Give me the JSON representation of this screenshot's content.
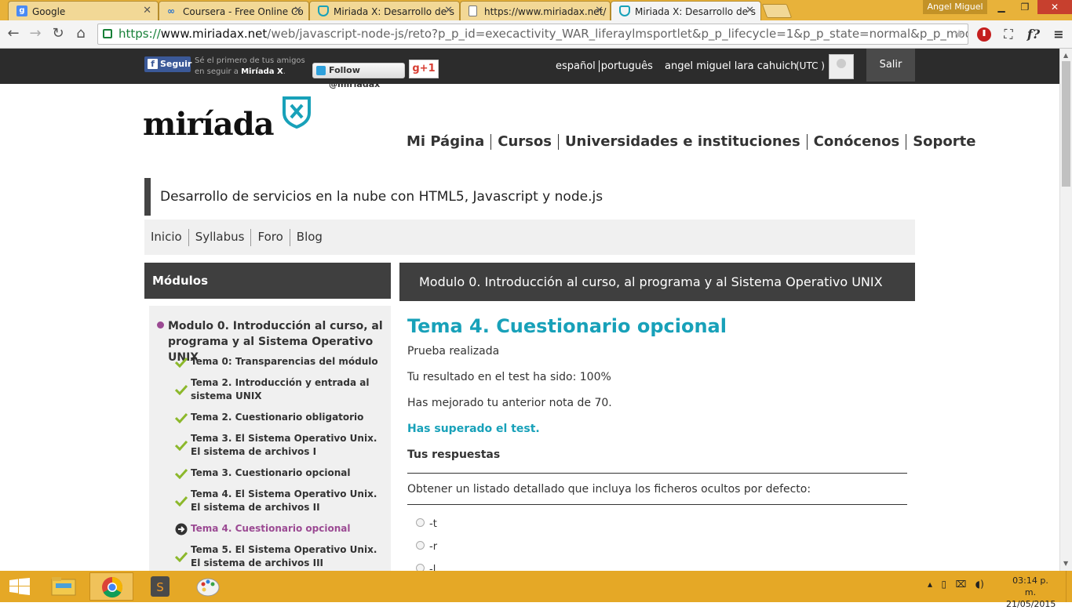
{
  "browser": {
    "tabs": [
      {
        "title": "Google",
        "icon": "google-icon",
        "active": false
      },
      {
        "title": "Coursera - Free Online Co",
        "icon": "coursera-icon",
        "active": false
      },
      {
        "title": "Miriada X: Desarrollo de s",
        "icon": "miriada-icon",
        "active": false
      },
      {
        "title": "https://www.miriadax.net/",
        "icon": "page-icon",
        "active": false
      },
      {
        "title": "Miriada X: Desarrollo de s",
        "icon": "miriada-icon",
        "active": true
      }
    ],
    "profile_name": "Angel Miguel",
    "url_scheme": "https://",
    "url_host": "www.miriadax.net",
    "url_rest": "/web/javascript-node-js/reto?p_p_id=execactivity_WAR_liferaylmsportlet&p_p_lifecycle=1&p_p_state=normal&p_p_mode=vie"
  },
  "topbar": {
    "fb_button": "Seguir",
    "fb_text_1": "Sé el primero de tus amigos en seguir a ",
    "fb_text_brand": "Miríada X",
    "fb_text_end": ".",
    "twitter_button": "Follow @miriadax",
    "gplus": "g+1",
    "lang_es": "español",
    "lang_pt": "português",
    "username": "angel miguel lara cahuich",
    "timezone": "(UTC )",
    "logout": "Salir"
  },
  "site": {
    "logo_text": "miríada",
    "menu": [
      "Mi Página",
      "Cursos",
      "Universidades e instituciones",
      "Conócenos",
      "Soporte"
    ],
    "course_title": "Desarrollo de servicios en la nube con HTML5, Javascript y node.js",
    "course_nav": [
      "Inicio",
      "Syllabus",
      "Foro",
      "Blog"
    ]
  },
  "sidebar": {
    "header": "Módulos",
    "module_title": "Modulo 0. Introducción al curso, al programa y al Sistema Operativo UNIX",
    "items": [
      {
        "label": "Tema 0: Transparencias del módulo",
        "status": "done"
      },
      {
        "label": "Tema 2. Introducción y entrada al sistema UNIX",
        "status": "done"
      },
      {
        "label": "Tema 2. Cuestionario obligatorio",
        "status": "done"
      },
      {
        "label": "Tema 3. El Sistema Operativo Unix. El sistema de archivos I",
        "status": "done"
      },
      {
        "label": "Tema 3. Cuestionario opcional",
        "status": "done"
      },
      {
        "label": "Tema 4. El Sistema Operativo Unix. El sistema de archivos II",
        "status": "done"
      },
      {
        "label": "Tema 4. Cuestionario opcional",
        "status": "current"
      },
      {
        "label": "Tema 5. El Sistema Operativo Unix. El sistema de archivos III",
        "status": "done"
      }
    ]
  },
  "content": {
    "header": "Modulo 0. Introducción al curso, al programa y al Sistema Operativo UNIX",
    "title": "Tema 4. Cuestionario opcional",
    "status": "Prueba realizada",
    "result": "Tu resultado en el test ha sido: 100%",
    "improved": "Has mejorado tu anterior nota de 70.",
    "passed": "Has superado el test.",
    "answers_heading": "Tus respuestas",
    "question": "Obtener un listado detallado que incluya los ficheros ocultos por defecto:",
    "options": [
      "-t",
      "-r",
      "-l"
    ]
  },
  "taskbar": {
    "time": "03:14 p. m.",
    "date": "21/05/2015"
  },
  "colors": {
    "accent_teal": "#18a1b9",
    "accent_purple": "#9b4a93",
    "check_green": "#8cb82b",
    "taskbar": "#e5a826"
  }
}
